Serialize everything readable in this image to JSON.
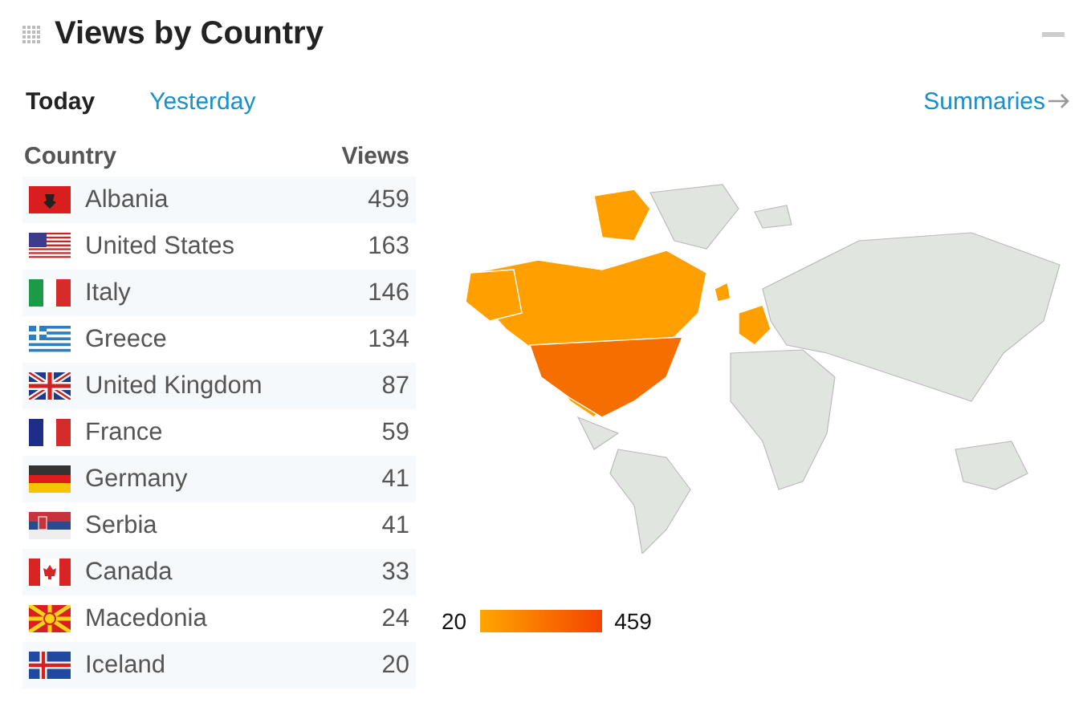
{
  "panel": {
    "title": "Views by Country"
  },
  "tabs": [
    {
      "label": "Today",
      "selected": true
    },
    {
      "label": "Yesterday",
      "selected": false
    }
  ],
  "summaries_link": "Summaries",
  "table": {
    "columns": [
      "Country",
      "Views"
    ],
    "rows": [
      {
        "country": "Albania",
        "views": "459"
      },
      {
        "country": "United States",
        "views": "163"
      },
      {
        "country": "Italy",
        "views": "146"
      },
      {
        "country": "Greece",
        "views": "134"
      },
      {
        "country": "United Kingdom",
        "views": "87"
      },
      {
        "country": "France",
        "views": "59"
      },
      {
        "country": "Germany",
        "views": "41"
      },
      {
        "country": "Serbia",
        "views": "41"
      },
      {
        "country": "Canada",
        "views": "33"
      },
      {
        "country": "Macedonia",
        "views": "24"
      },
      {
        "country": "Iceland",
        "views": "20"
      }
    ]
  },
  "legend": {
    "min": "20",
    "max": "459"
  }
}
